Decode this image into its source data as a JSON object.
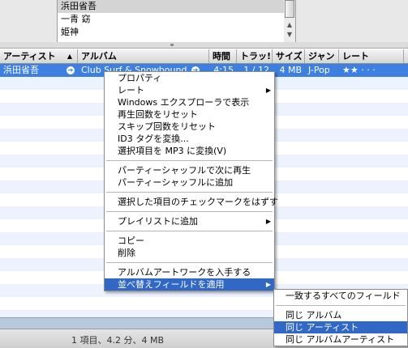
{
  "browser": {
    "items": [
      {
        "label": "浜田省吾",
        "selected": true
      },
      {
        "label": "一青 窈",
        "selected": false
      },
      {
        "label": "姫神",
        "selected": false
      }
    ]
  },
  "columns": {
    "artist": "アーティスト",
    "album": "アルバム",
    "time": "時間",
    "track": "トラッ!",
    "size": "サイズ",
    "genre": "ジャン",
    "rating": "レート"
  },
  "selected_track": {
    "artist": "浜田省吾",
    "album": "Club Surf & Snowbound",
    "time": "4:15",
    "track": "1 / 12",
    "size": "4 MB",
    "genre": "J-Pop",
    "rating_stars": 2,
    "rating_max": 5,
    "rating_display": "★★ · · ·"
  },
  "context_menu": {
    "groups": [
      [
        "プロパティ",
        "レート",
        "Windows エクスプローラで表示",
        "再生回数をリセット",
        "スキップ回数をリセット",
        "ID3 タグを変換...",
        "選択項目を MP3 に変換(V)"
      ],
      [
        "パーティーシャッフルで次に再生",
        "パーティーシャッフルに追加"
      ],
      [
        "選択した項目のチェックマークをはずす"
      ],
      [
        "プレイリストに追加"
      ],
      [
        "コピー",
        "削除"
      ],
      [
        "アルバムアートワークを入手する",
        "並べ替えフィールドを適用"
      ]
    ],
    "submenu_items": [
      "レート",
      "プレイリストに追加",
      "並べ替えフィールドを適用"
    ],
    "highlighted": "並べ替えフィールドを適用"
  },
  "submenu": {
    "items": [
      "一致するすべてのフィールド",
      "同じ アルバム",
      "同じ アーティスト",
      "同じ アルバムアーティスト"
    ],
    "highlighted": "同じ アーティスト"
  },
  "status": {
    "text": "1 項目、4.2 分、4 MB"
  },
  "colors": {
    "selection_row": "#3d80df",
    "menu_highlight": "#3168c5",
    "stripe": "#edf3fe"
  }
}
